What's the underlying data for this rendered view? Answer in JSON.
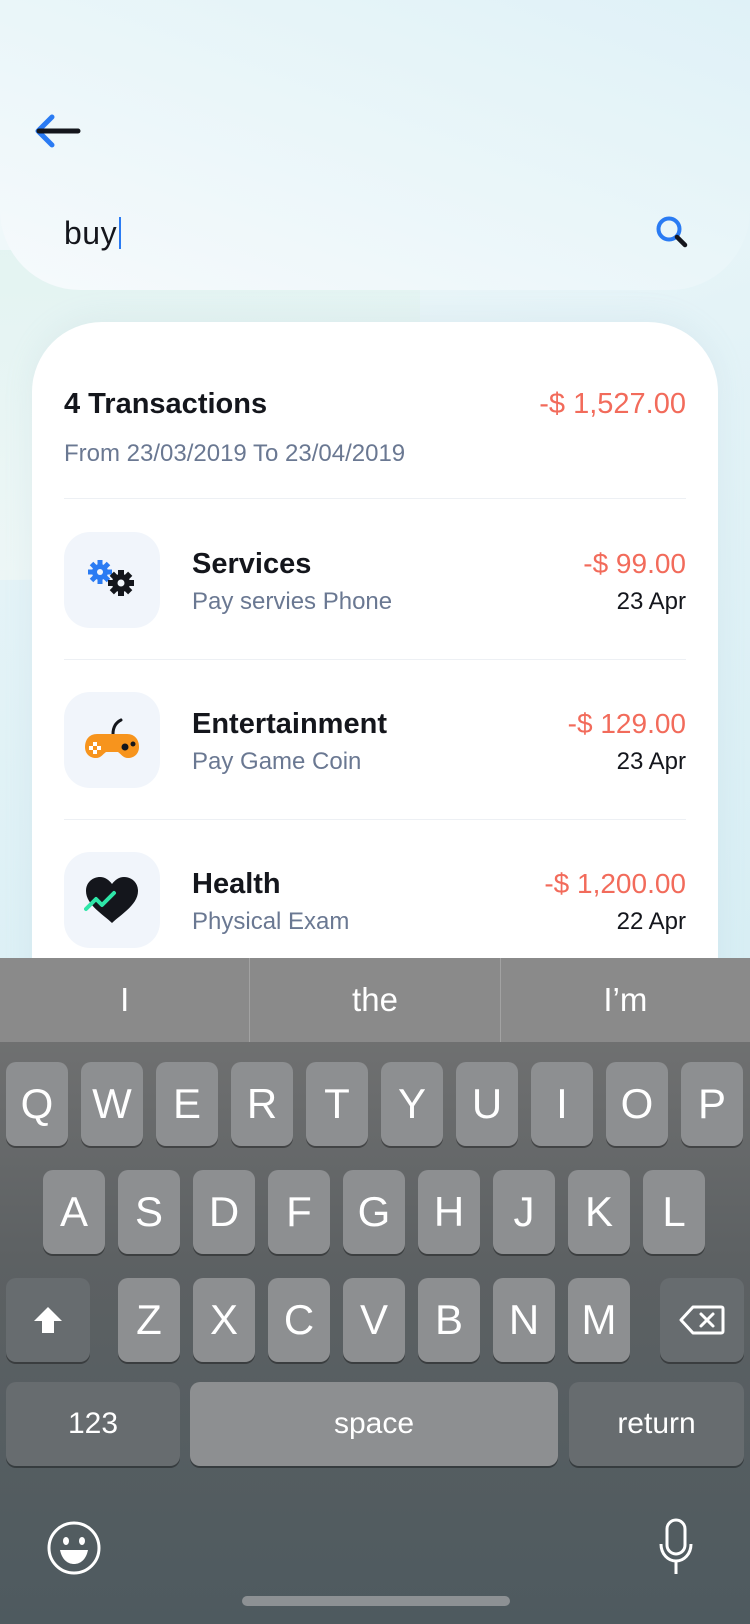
{
  "search": {
    "query": "buy"
  },
  "summary": {
    "count_label": "4 Transactions",
    "total": "-$ 1,527.00",
    "range": "From 23/03/2019 To 23/04/2019"
  },
  "transactions": [
    {
      "icon": "gears-icon",
      "title": "Services",
      "subtitle": "Pay servies Phone",
      "amount": "-$ 99.00",
      "date": "23 Apr"
    },
    {
      "icon": "gamepad-icon",
      "title": "Entertainment",
      "subtitle": "Pay Game Coin",
      "amount": "-$ 129.00",
      "date": "23 Apr"
    },
    {
      "icon": "heart-pulse-icon",
      "title": "Health",
      "subtitle": "Physical Exam",
      "amount": "-$ 1,200.00",
      "date": "22 Apr"
    }
  ],
  "keyboard": {
    "suggestions": [
      "I",
      "the",
      "I’m"
    ],
    "row1": [
      "Q",
      "W",
      "E",
      "R",
      "T",
      "Y",
      "U",
      "I",
      "O",
      "P"
    ],
    "row2": [
      "A",
      "S",
      "D",
      "F",
      "G",
      "H",
      "J",
      "K",
      "L"
    ],
    "row3": [
      "Z",
      "X",
      "C",
      "V",
      "B",
      "N",
      "M"
    ],
    "numbers_label": "123",
    "space_label": "space",
    "return_label": "return"
  },
  "colors": {
    "accent": "#2a7bf3",
    "negative": "#f26b5b",
    "text": "#14161c",
    "muted": "#6a7892"
  }
}
